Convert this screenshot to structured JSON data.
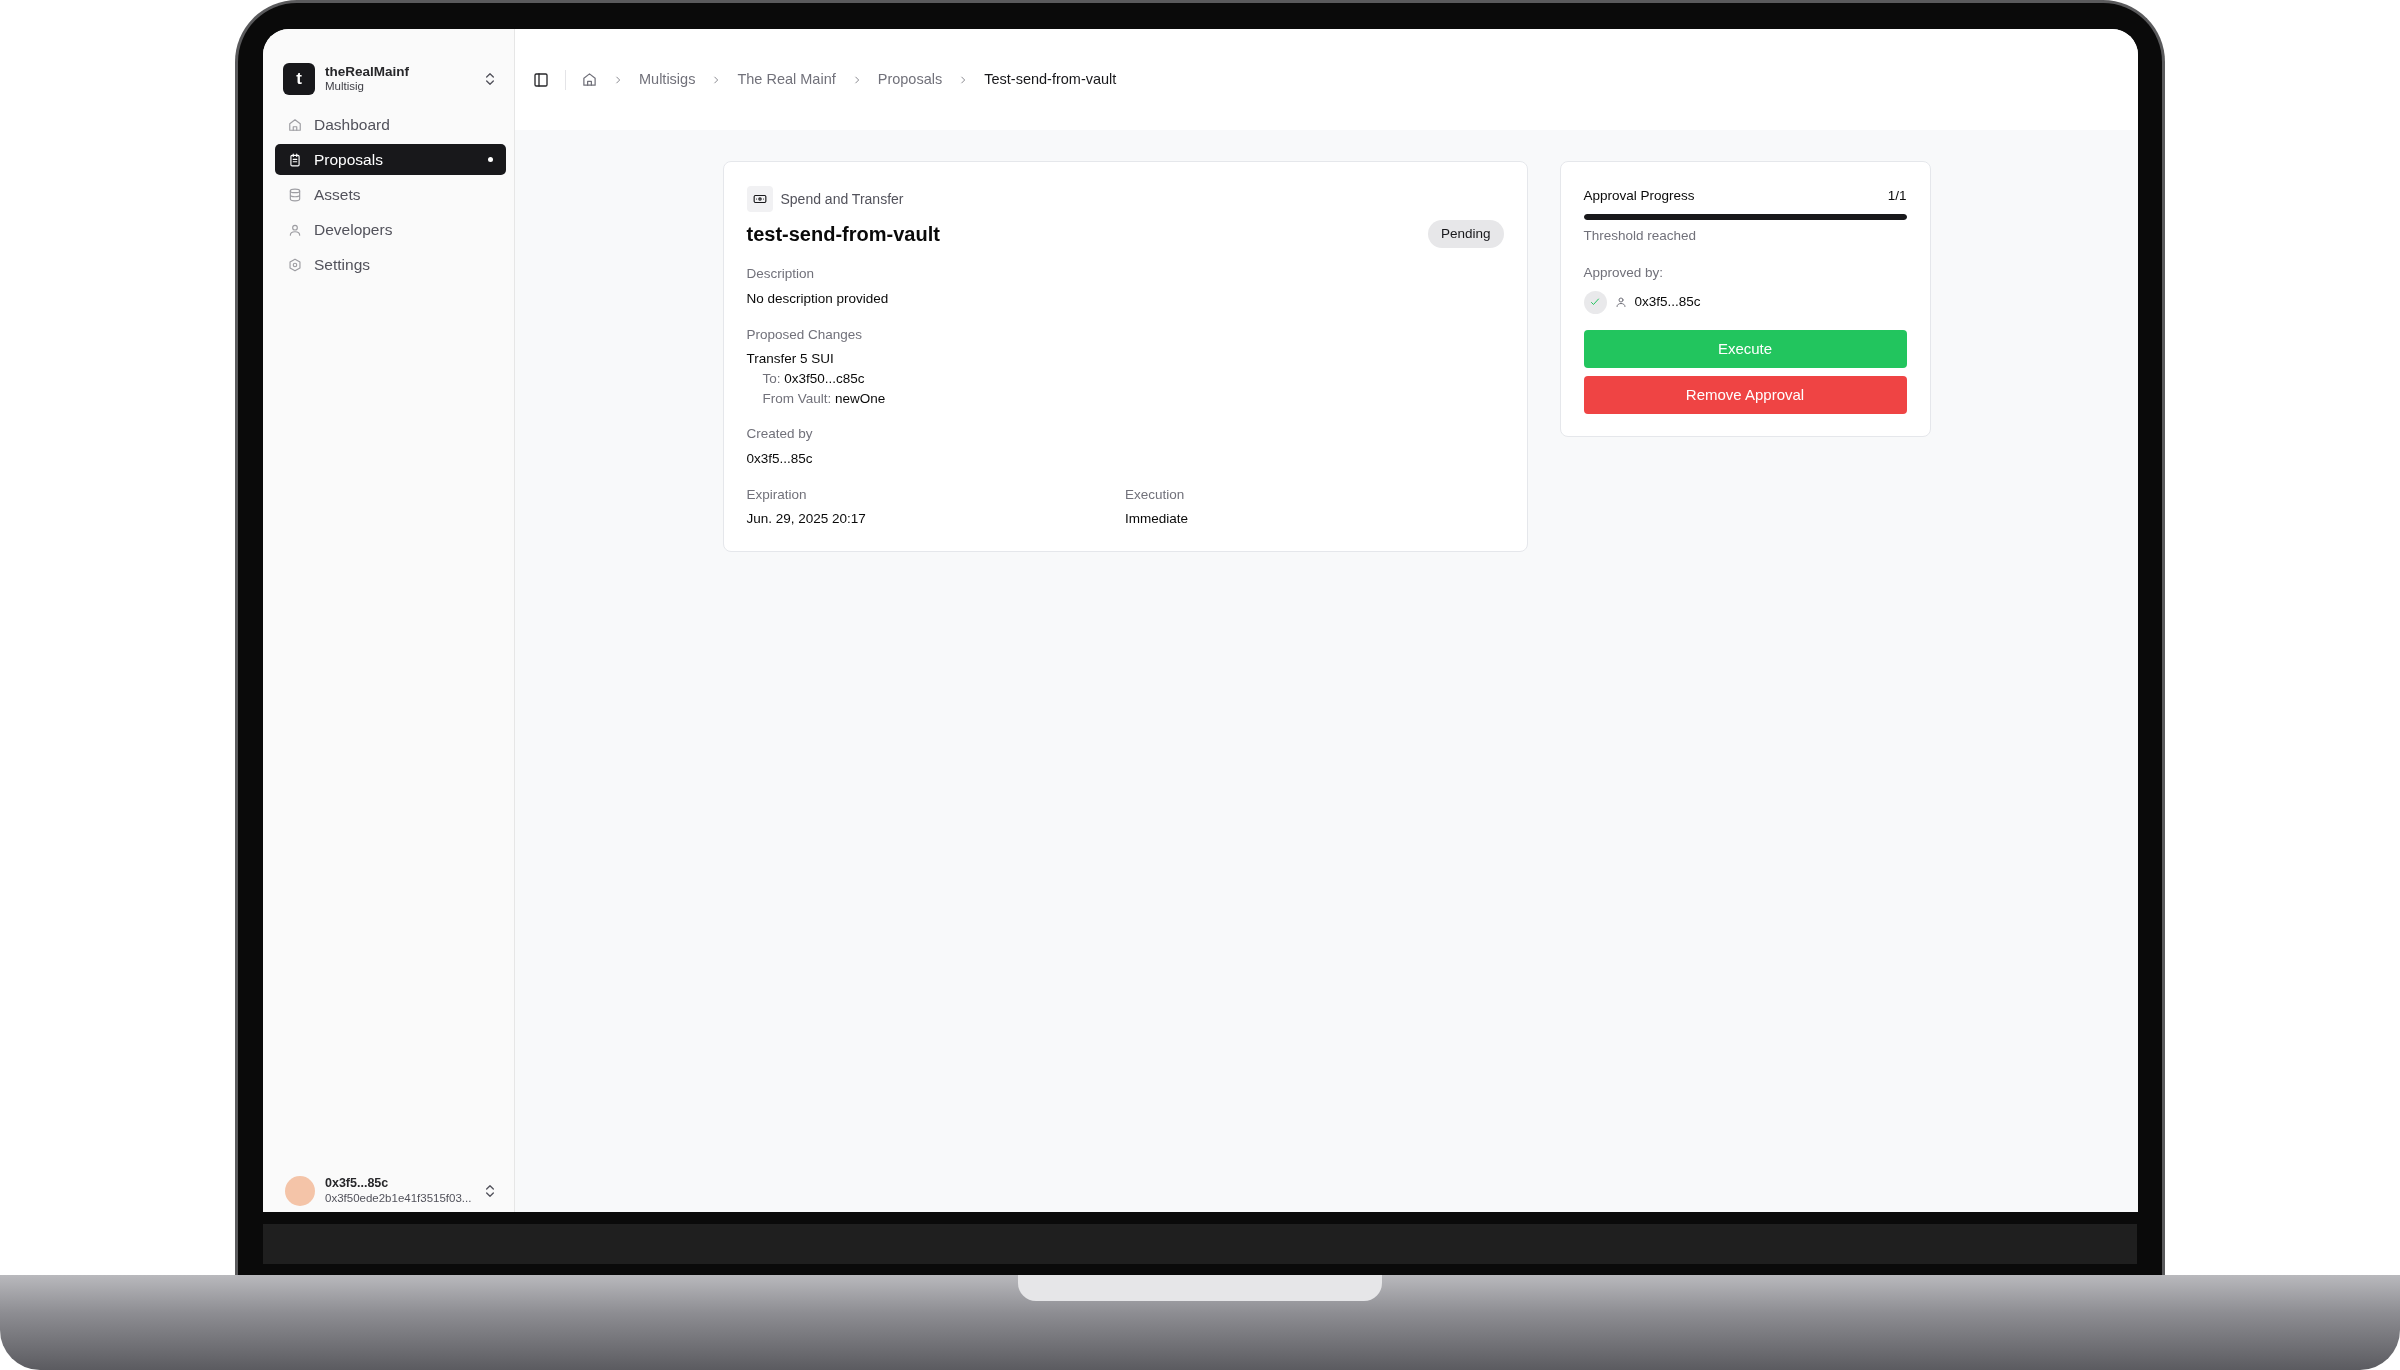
{
  "workspace": {
    "initial": "t",
    "name": "theRealMainf",
    "type": "Multisig"
  },
  "nav": [
    {
      "label": "Dashboard",
      "kind": "home",
      "selected": false
    },
    {
      "label": "Proposals",
      "kind": "clipboard",
      "selected": true
    },
    {
      "label": "Assets",
      "kind": "database",
      "selected": false
    },
    {
      "label": "Developers",
      "kind": "person",
      "selected": false
    },
    {
      "label": "Settings",
      "kind": "gear",
      "selected": false
    }
  ],
  "user": {
    "name": "0x3f5...85c",
    "address": "0x3f50ede2b1e41f3515f03..."
  },
  "breadcrumbs": [
    {
      "label": "Multisigs",
      "current": false
    },
    {
      "label": "The Real Mainf",
      "current": false
    },
    {
      "label": "Proposals",
      "current": false
    },
    {
      "label": "Test-send-from-vault",
      "current": true
    }
  ],
  "proposal": {
    "category": "Spend and Transfer",
    "title": "test-send-from-vault",
    "status": "Pending",
    "description_label": "Description",
    "description": "No description provided",
    "changes_label": "Proposed Changes",
    "change": {
      "title": "Transfer 5 SUI",
      "details": [
        {
          "label": "To:",
          "value": "0x3f50...c85c"
        },
        {
          "label": "From Vault:",
          "value": "newOne"
        }
      ]
    },
    "created_by_label": "Created by",
    "created_by": "0x3f5...85c",
    "expiration_label": "Expiration",
    "expiration": "Jun. 29, 2025 20:17",
    "execution_label": "Execution",
    "execution": "Immediate"
  },
  "approval": {
    "title": "Approval Progress",
    "count": "1/1",
    "level": 1,
    "note": "Threshold reached",
    "approved_by_label": "Approved by:",
    "approvers": [
      {
        "address": "0x3f5...85c",
        "approved": true
      }
    ],
    "buttons": [
      {
        "label": "Execute",
        "kind": "execute"
      },
      {
        "label": "Remove Approval",
        "kind": "remove"
      }
    ]
  }
}
